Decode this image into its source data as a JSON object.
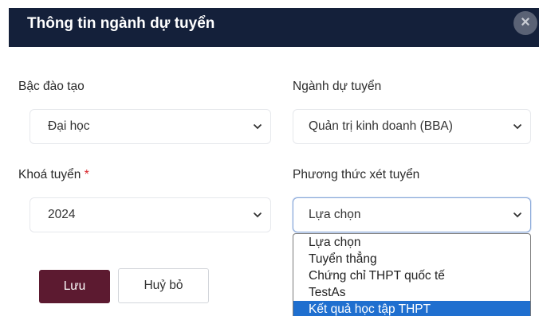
{
  "modal": {
    "title": "Thông tin ngành dự tuyển",
    "close_symbol": "×"
  },
  "form": {
    "level": {
      "label": "Bậc đào tạo",
      "value": "Đại học"
    },
    "major": {
      "label": "Ngành dự tuyển",
      "value": "Quản trị kinh doanh (BBA)"
    },
    "intake": {
      "label": "Khoá tuyển",
      "required_mark": "*",
      "value": "2024"
    },
    "method": {
      "label": "Phương thức xét tuyển",
      "value": "Lựa chọn",
      "options": [
        "Lựa chọn",
        "Tuyển thẳng",
        "Chứng chỉ THPT quốc tế",
        "TestAs",
        "Kết quả học tập THPT"
      ],
      "highlighted_index": 4
    }
  },
  "actions": {
    "save_label": "Lưu",
    "cancel_label": "Huỷ bỏ"
  },
  "colors": {
    "header_bg": "#14203a",
    "primary_button": "#5c1a30",
    "option_highlight": "#1f6fcf",
    "required": "#d8262c"
  }
}
